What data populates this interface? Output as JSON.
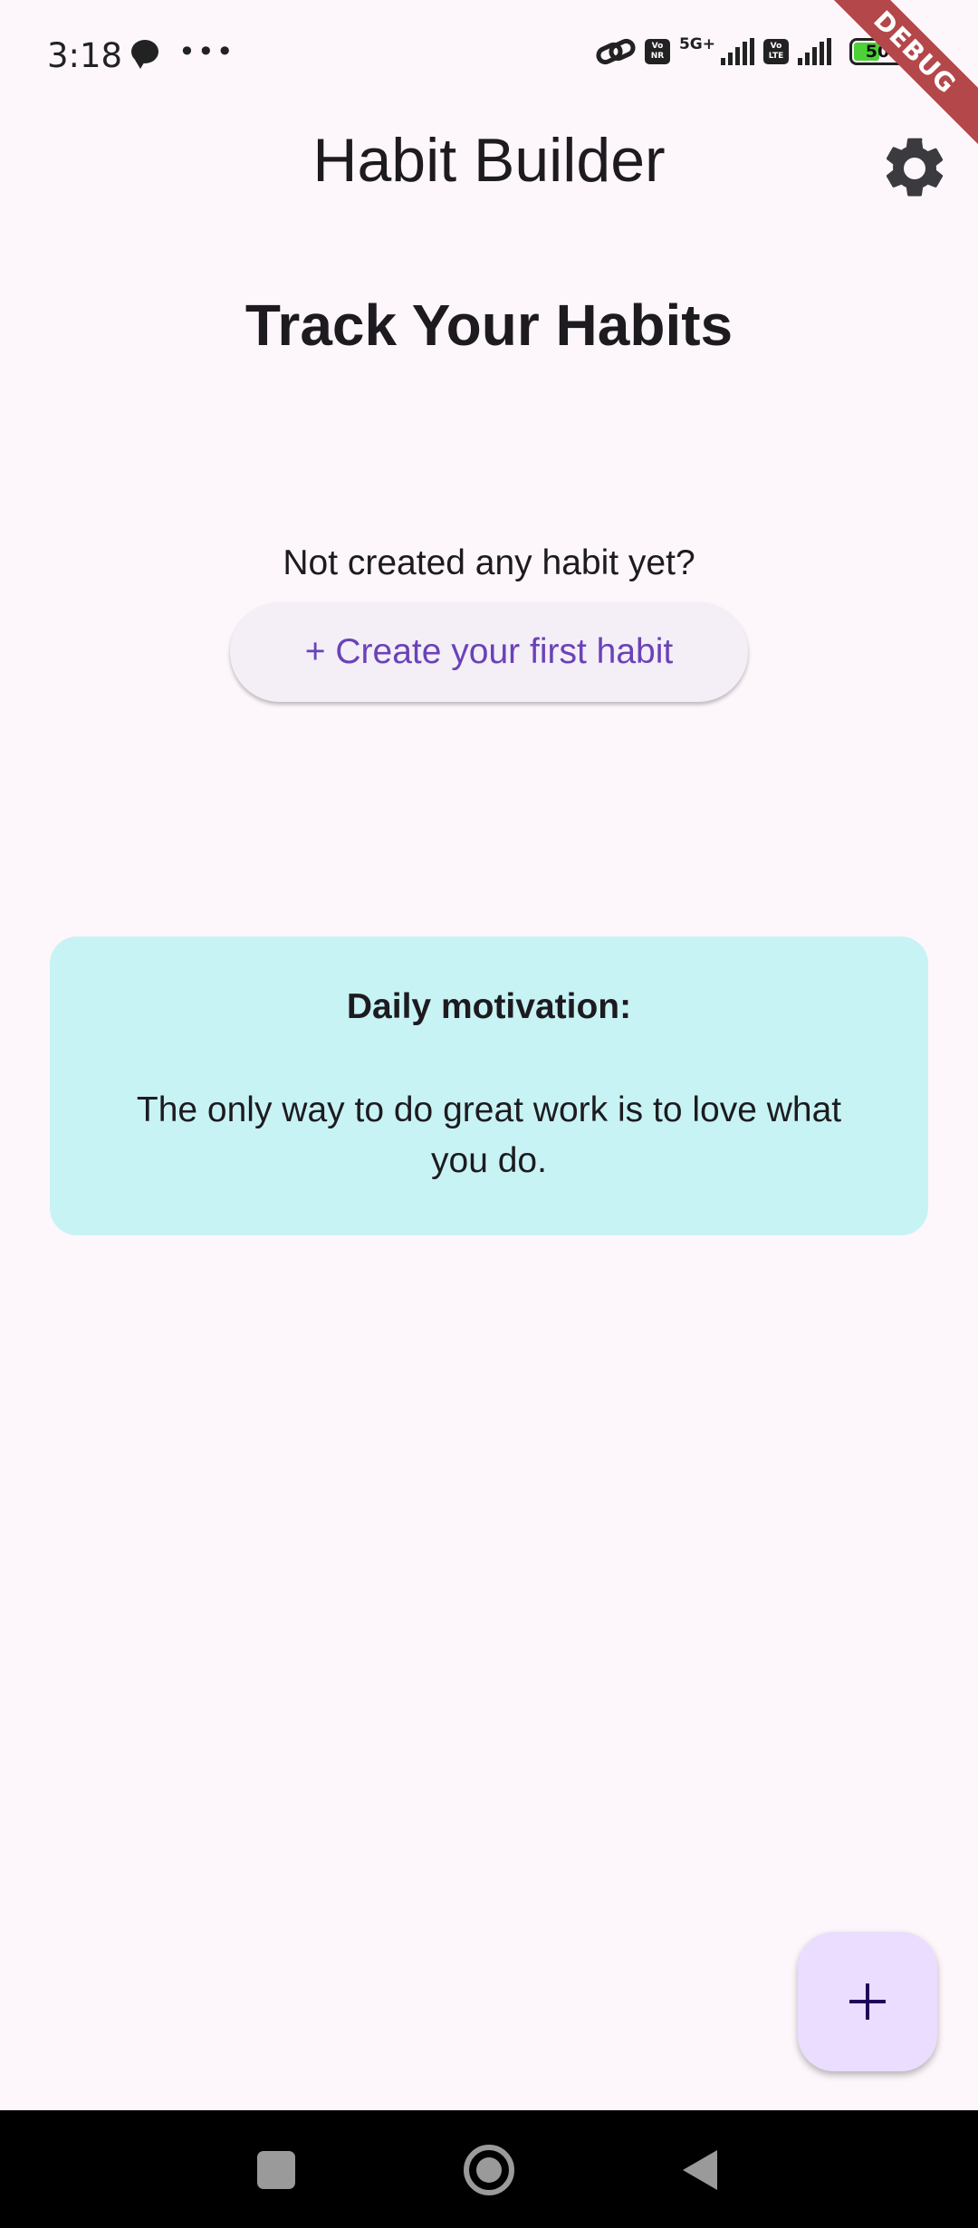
{
  "status_bar": {
    "time": "3:18",
    "network_label": "5G+",
    "volte_1": "Vo NR",
    "volte_2": "Vo LTE",
    "battery_level": "50",
    "icons": [
      "chat-bubble-icon",
      "more-dots-icon",
      "link-icon",
      "volte-icon",
      "signal-icon",
      "battery-icon"
    ]
  },
  "debug_banner": "DEBUG",
  "app_bar": {
    "title": "Habit Builder",
    "settings_icon": "gear-icon"
  },
  "main": {
    "heading": "Track Your Habits",
    "empty_state_text": "Not created any habit yet?",
    "create_button_label": "+ Create your first habit"
  },
  "motivation": {
    "title": "Daily motivation:",
    "quote": "The only way to do great work is to love what you do."
  },
  "fab": {
    "icon": "plus-icon"
  },
  "nav_bar": {
    "icons": [
      "recents-icon",
      "home-icon",
      "back-icon"
    ]
  },
  "colors": {
    "background": "#fdf7fb",
    "button_bg": "#f4eef7",
    "button_text": "#6a42b8",
    "card_bg": "#c8f3f4",
    "fab_bg": "#eaddff",
    "debug_ribbon": "#b4474a"
  }
}
